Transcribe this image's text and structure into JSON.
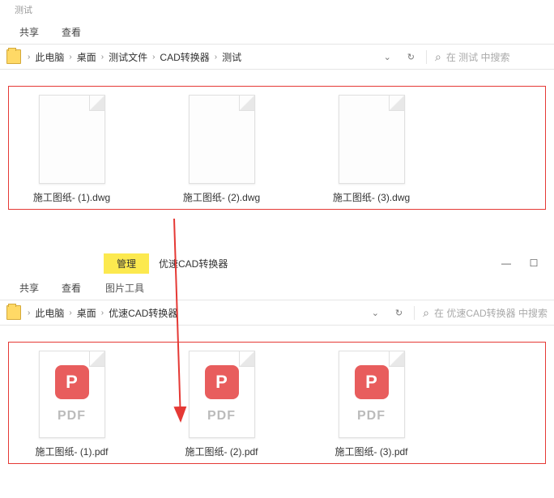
{
  "window1": {
    "title_faded": "测试",
    "tabs": {
      "share": "共享",
      "view": "查看"
    },
    "breadcrumb": [
      "此电脑",
      "桌面",
      "测试文件",
      "CAD转换器",
      "测试"
    ],
    "search_placeholder": "在 测试 中搜索",
    "files": [
      {
        "name": "施工图纸- (1).dwg"
      },
      {
        "name": "施工图纸- (2).dwg"
      },
      {
        "name": "施工图纸- (3).dwg"
      }
    ]
  },
  "window2": {
    "manage": "管理",
    "tool": "图片工具",
    "app_title": "优速CAD转换器",
    "tabs": {
      "share": "共享",
      "view": "查看"
    },
    "breadcrumb": [
      "此电脑",
      "桌面",
      "优速CAD转换器"
    ],
    "search_placeholder": "在 优速CAD转换器 中搜索",
    "files": [
      {
        "name": "施工图纸- (1).pdf"
      },
      {
        "name": "施工图纸- (2).pdf"
      },
      {
        "name": "施工图纸- (3).pdf"
      }
    ],
    "pdf_label": "PDF",
    "pdf_badge": "P"
  },
  "icons": {
    "chevron": "›",
    "dropdown": "⌄",
    "refresh": "↻",
    "search": "🔍",
    "minimize": "—",
    "maximize": "☐"
  }
}
